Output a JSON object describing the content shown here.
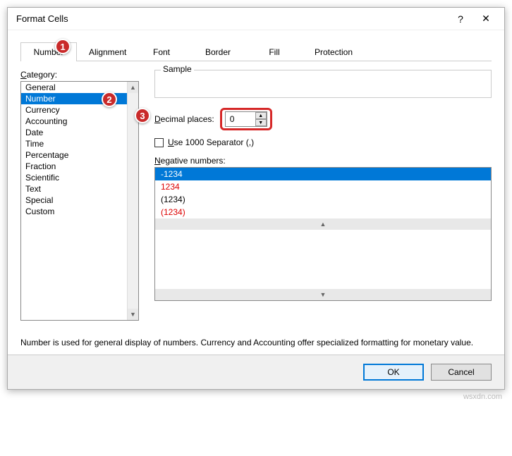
{
  "window": {
    "title": "Format Cells",
    "help": "?",
    "close": "✕"
  },
  "tabs": [
    "Number",
    "Alignment",
    "Font",
    "Border",
    "Fill",
    "Protection"
  ],
  "active_tab": 0,
  "category": {
    "label": "Category:",
    "items": [
      "General",
      "Number",
      "Currency",
      "Accounting",
      "Date",
      "Time",
      "Percentage",
      "Fraction",
      "Scientific",
      "Text",
      "Special",
      "Custom"
    ],
    "selected": 1
  },
  "sample": {
    "label": "Sample",
    "value": ""
  },
  "decimal": {
    "label": "Decimal places:",
    "value": "0"
  },
  "separator": {
    "label": "Use 1000 Separator (,)",
    "checked": false
  },
  "negative": {
    "label": "Negative numbers:",
    "items": [
      {
        "text": "-1234",
        "red": false,
        "sel": true
      },
      {
        "text": "1234",
        "red": true,
        "sel": false
      },
      {
        "text": "(1234)",
        "red": false,
        "sel": false
      },
      {
        "text": "(1234)",
        "red": true,
        "sel": false
      }
    ]
  },
  "description": "Number is used for general display of numbers.  Currency and Accounting offer specialized formatting for monetary value.",
  "buttons": {
    "ok": "OK",
    "cancel": "Cancel"
  },
  "callouts": {
    "c1": "1",
    "c2": "2",
    "c3": "3"
  },
  "watermark": "wsxdn.com"
}
